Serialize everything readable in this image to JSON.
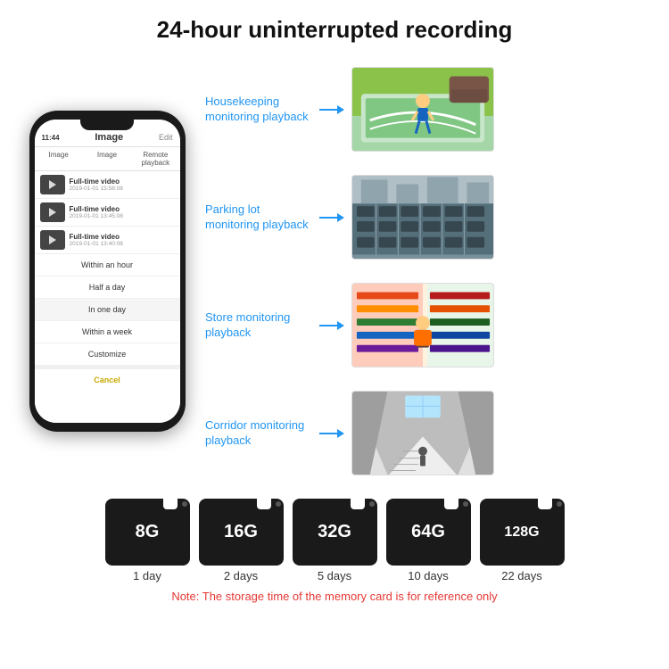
{
  "header": {
    "title": "24-hour uninterrupted recording"
  },
  "phone": {
    "time": "11:44",
    "screen_title": "Image",
    "edit_label": "Edit",
    "back_label": "<",
    "tabs": [
      {
        "label": "Image",
        "active": true
      },
      {
        "label": "Image",
        "active": false
      },
      {
        "label": "Remote playback",
        "active": false
      }
    ],
    "videos": [
      {
        "title": "Full-time video",
        "date": "2019-01-01 15:58:08"
      },
      {
        "title": "Full-time video",
        "date": "2019-01-01 13:45:08"
      },
      {
        "title": "Full-time video",
        "date": "2019-01-01 13:40:08"
      }
    ],
    "dropdown_items": [
      {
        "label": "Within an hour"
      },
      {
        "label": "Half a day"
      },
      {
        "label": "In one day"
      },
      {
        "label": "Within a week"
      },
      {
        "label": "Customize"
      }
    ],
    "cancel_label": "Cancel"
  },
  "monitoring": [
    {
      "label": "Housekeeping\nmonitoring playback",
      "img_class": "img-housekeeping"
    },
    {
      "label": "Parking lot\nmonitoring playback",
      "img_class": "img-parking"
    },
    {
      "label": "Store monitoring\nplayback",
      "img_class": "img-store"
    },
    {
      "label": "Corridor monitoring\nplayback",
      "img_class": "img-corridor"
    }
  ],
  "sd_cards": [
    {
      "size": "8G",
      "days": "1 day"
    },
    {
      "size": "16G",
      "days": "2 days"
    },
    {
      "size": "32G",
      "days": "5 days"
    },
    {
      "size": "64G",
      "days": "10 days"
    },
    {
      "size": "128G",
      "days": "22 days"
    }
  ],
  "note": "Note: The storage time of the memory card is for reference only"
}
